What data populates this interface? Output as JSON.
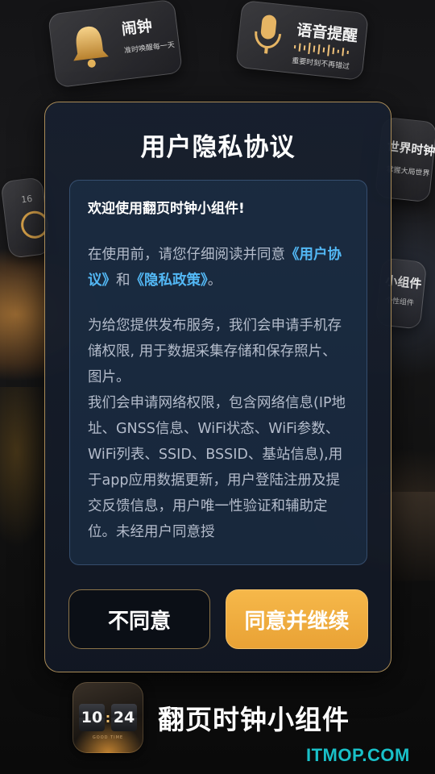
{
  "tiles": {
    "alarm": {
      "title": "闹钟",
      "subtitle": "准时唤醒每一天"
    },
    "voice": {
      "title": "语音提醒",
      "subtitle": "重要时刻不再错过"
    },
    "world_clock": {
      "title": "世界时钟",
      "subtitle": "掌握大局世界"
    },
    "widget": {
      "title": "小组件",
      "subtitle": "个性组件"
    },
    "counter": {
      "badge": "16"
    }
  },
  "dialog": {
    "title": "用户隐私协议",
    "welcome": "欢迎使用翻页时钟小组件!",
    "intro_prefix": "在使用前，请您仔细阅读并同意",
    "user_agreement_link": "《用户协议》",
    "intro_and": "和",
    "privacy_policy_link": "《隐私政策》",
    "intro_suffix": "。",
    "para_storage": "为给您提供发布服务，我们会申请手机存储权限, 用于数据采集存储和保存照片、图片。",
    "para_network": "我们会申请网络权限，包含网络信息(IP地址、GNSS信息、WiFi状态、WiFi参数、WiFi列表、SSID、BSSID、基站信息),用于app应用数据更新，用户登陆注册及提交反馈信息，用户唯一性验证和辅助定位。未经用户同意授",
    "disagree_label": "不同意",
    "agree_label": "同意并继续"
  },
  "footer": {
    "app_name": "翻页时钟小组件",
    "icon_hour": "10",
    "icon_minute": "24",
    "icon_caption": "GOOD TIME"
  },
  "watermark": "ITMOP.COM",
  "colors": {
    "accent_gold": "#c4a060",
    "agree_orange": "#f2ad3f",
    "link_blue": "#53b8f5",
    "watermark_teal": "#19c0c8"
  }
}
